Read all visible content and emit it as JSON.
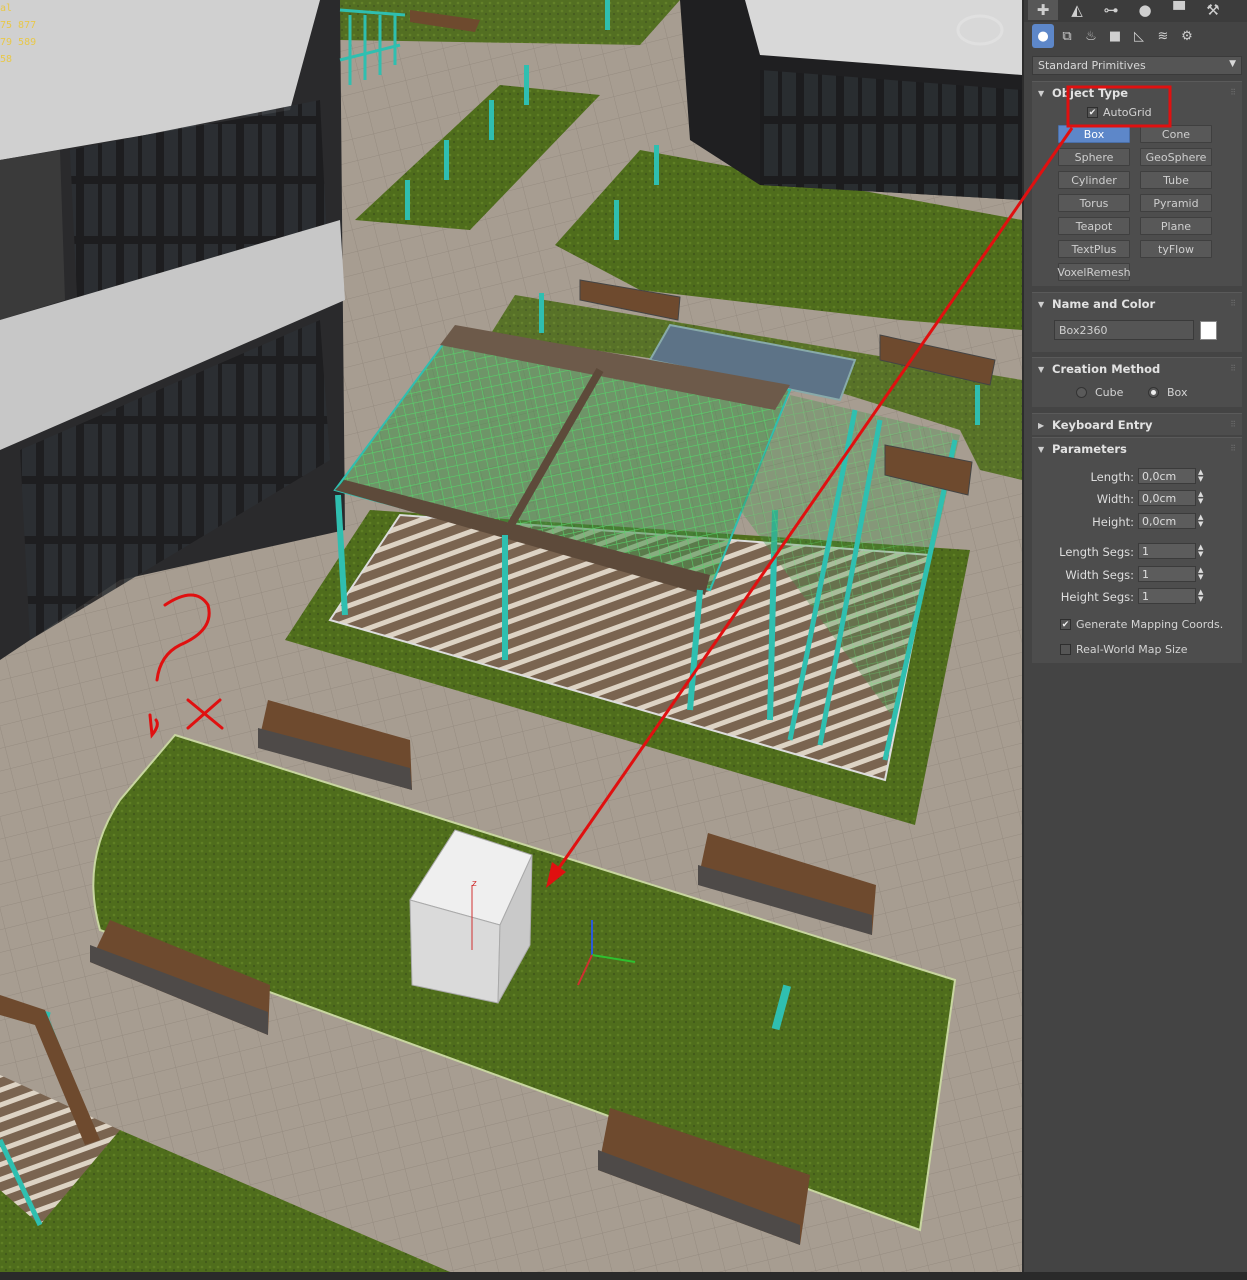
{
  "viewport": {
    "hud_lines": [
      "al",
      "75 877",
      "79 589",
      "",
      "58"
    ],
    "gizmo_axis_z": "z"
  },
  "panel": {
    "tabs": [
      "create-icon",
      "modify-icon",
      "hierarchy-icon",
      "motion-icon",
      "display-icon",
      "utilities-icon"
    ],
    "categories": [
      "geometry-icon",
      "shapes-icon",
      "lights-icon",
      "cameras-icon",
      "helpers-icon",
      "spacewarps-icon",
      "systems-icon"
    ],
    "dropdown_value": "Standard Primitives",
    "object_type": {
      "title": "Object Type",
      "autogrid_label": "AutoGrid",
      "autogrid_checked": true,
      "buttons": [
        "Box",
        "Cone",
        "Sphere",
        "GeoSphere",
        "Cylinder",
        "Tube",
        "Torus",
        "Pyramid",
        "Teapot",
        "Plane",
        "TextPlus",
        "tyFlow",
        "VoxelRemesh"
      ],
      "active_button": "Box"
    },
    "name_color": {
      "title": "Name and Color",
      "name_value": "Box2360",
      "color": "#ffffff"
    },
    "creation_method": {
      "title": "Creation Method",
      "options": [
        "Cube",
        "Box"
      ],
      "selected": "Box"
    },
    "keyboard_entry": {
      "title": "Keyboard Entry"
    },
    "parameters": {
      "title": "Parameters",
      "length_label": "Length:",
      "length_value": "0,0cm",
      "width_label": "Width:",
      "width_value": "0,0cm",
      "height_label": "Height:",
      "height_value": "0,0cm",
      "length_segs_label": "Length Segs:",
      "length_segs_value": "1",
      "width_segs_label": "Width Segs:",
      "width_segs_value": "1",
      "height_segs_label": "Height Segs:",
      "height_segs_value": "1",
      "gen_mapping_label": "Generate Mapping Coords.",
      "gen_mapping_checked": true,
      "real_world_label": "Real-World Map Size",
      "real_world_checked": false
    }
  },
  "annotation_color": "#e01010"
}
